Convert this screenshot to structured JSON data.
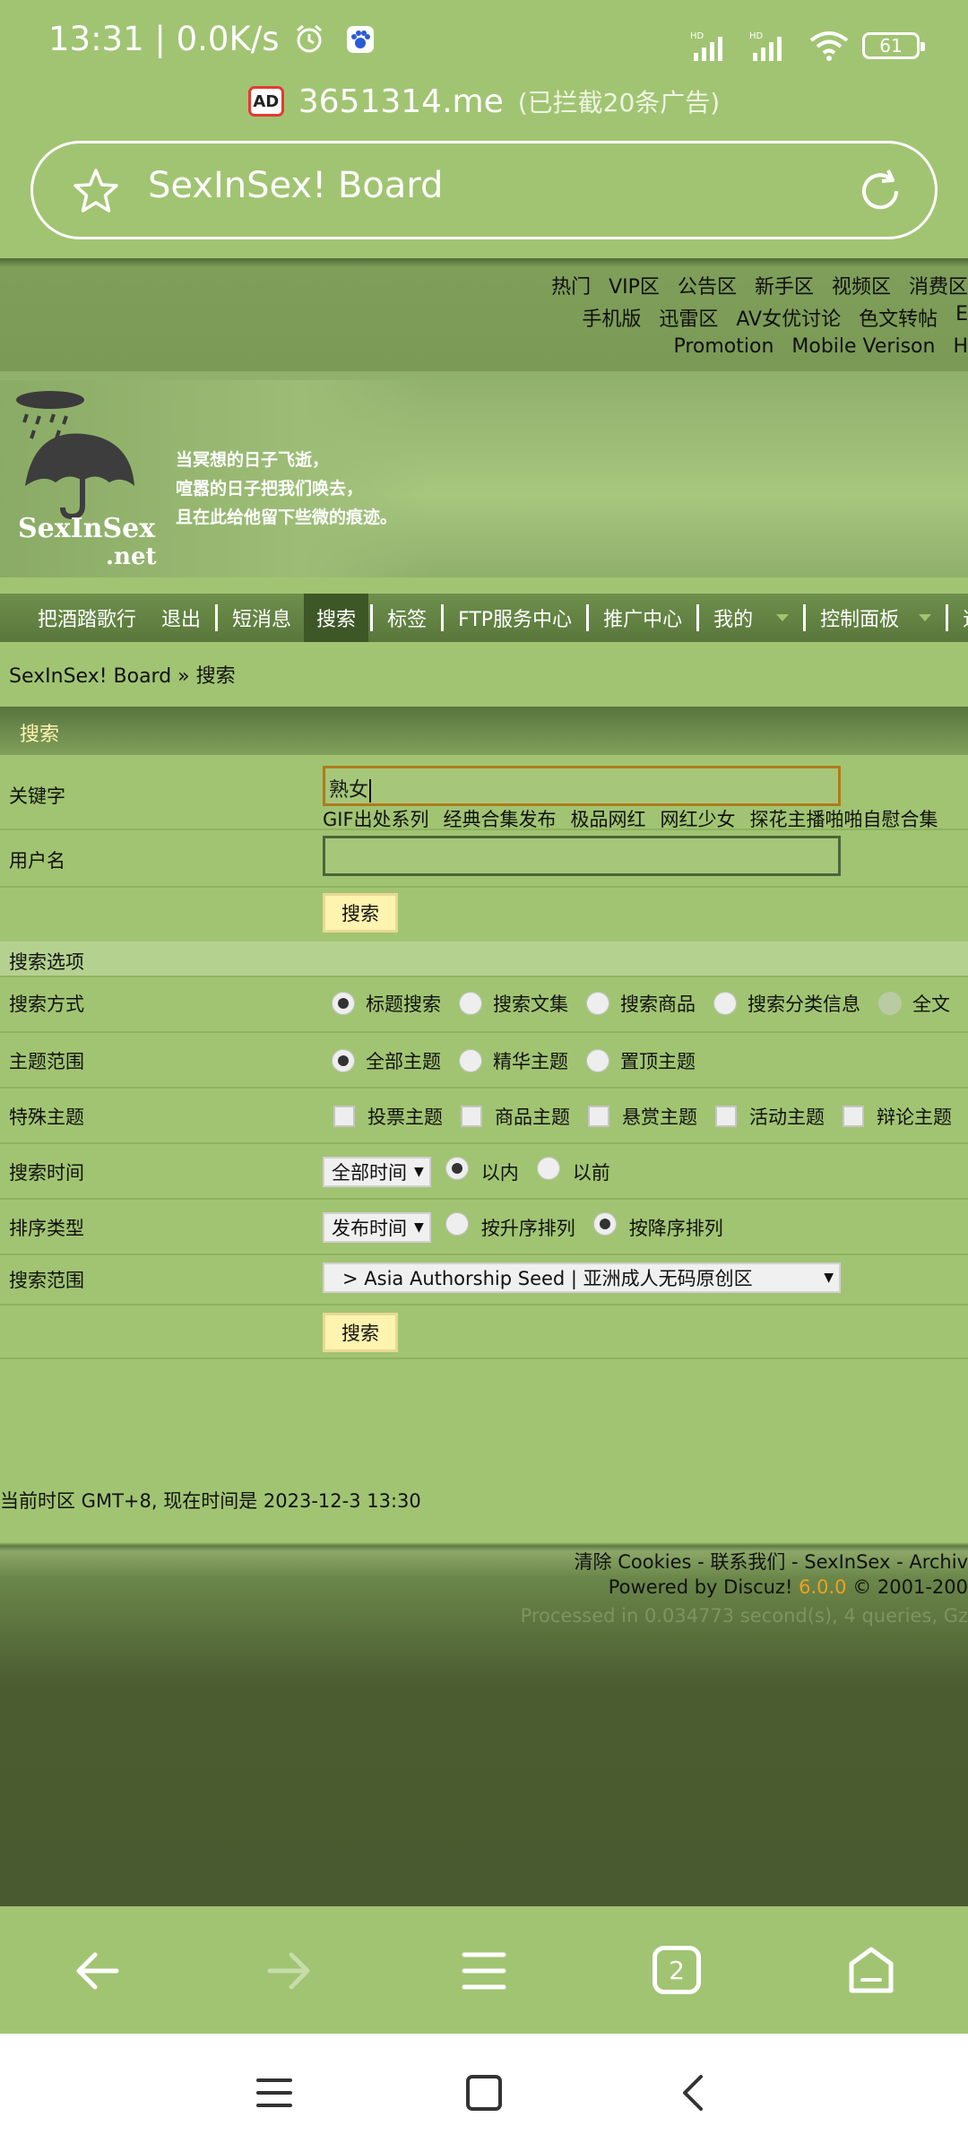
{
  "status_bar": {
    "time_speed": "13:31 | 0.0K/s",
    "battery": "61",
    "signal1_label": "HD",
    "signal2_label": "HD"
  },
  "url_line": {
    "ad_badge": "AD",
    "domain": "3651314.me",
    "blocked": "(已拦截20条广告)"
  },
  "address_bar": {
    "title": "SexInSex! Board"
  },
  "header_links": {
    "row1": [
      "热门",
      "VIP区",
      "公告区",
      "新手区",
      "视频区",
      "消费区"
    ],
    "row2": [
      "手机版",
      "迅雷区",
      "AV女优讨论",
      "色文转帖",
      "E"
    ],
    "row3": [
      "Promotion",
      "Mobile Verison",
      "H"
    ]
  },
  "banner": {
    "logo": "SexInSex",
    "logo_net": ".net",
    "poem": [
      "当冥想的日子飞逝，",
      "喧嚣的日子把我们唤去，",
      "且在此给他留下些微的痕迹。"
    ]
  },
  "nav": {
    "items": [
      "把酒踏歌行",
      "退出",
      "短消息",
      "搜索",
      "标签",
      "FTP服务中心",
      "推广中心",
      "我的",
      "控制面板",
      "道具"
    ],
    "active": "搜索"
  },
  "breadcrumb": "SexInSex! Board » 搜索",
  "section_title": "搜索",
  "form": {
    "keyword_label": "关键字",
    "keyword_value": "熟女",
    "hot_tags": [
      "GIF出处系列",
      "经典合集发布",
      "极品网红",
      "网红少女",
      "探花主播啪啪自慰合集"
    ],
    "username_label": "用户名",
    "username_value": "",
    "search_button": "搜索",
    "options_header": "搜索选项",
    "search_method": {
      "label": "搜索方式",
      "options": [
        "标题搜索",
        "搜索文集",
        "搜索商品",
        "搜索分类信息",
        "全文"
      ],
      "selected": "标题搜索"
    },
    "topic_range": {
      "label": "主题范围",
      "options": [
        "全部主题",
        "精华主题",
        "置顶主题"
      ],
      "selected": "全部主题"
    },
    "special_topics": {
      "label": "特殊主题",
      "options": [
        "投票主题",
        "商品主题",
        "悬赏主题",
        "活动主题",
        "辩论主题"
      ]
    },
    "search_time": {
      "label": "搜索时间",
      "select_value": "全部时间",
      "options": [
        "以内",
        "以前"
      ],
      "selected": "以内"
    },
    "sort_type": {
      "label": "排序类型",
      "select_value": "发布时间",
      "options": [
        "按升序排列",
        "按降序排列"
      ],
      "selected": "按降序排列"
    },
    "search_scope": {
      "label": "搜索范围",
      "select_value": "> Asia Authorship Seed | 亚洲成人无码原创区"
    },
    "submit_button": "搜索"
  },
  "timezone": "当前时区 GMT+8, 现在时间是 2023-12-3 13:30",
  "footer": {
    "links": "清除 Cookies - 联系我们 - SexInSex - Archiv",
    "powered_prefix": "Powered by Discuz!",
    "version": "6.0.0",
    "copyright": "© 2001-200",
    "processed": "Processed in 0.034773 second(s), 4 queries, Gz"
  },
  "browser_bar": {
    "tab_count": "2"
  }
}
